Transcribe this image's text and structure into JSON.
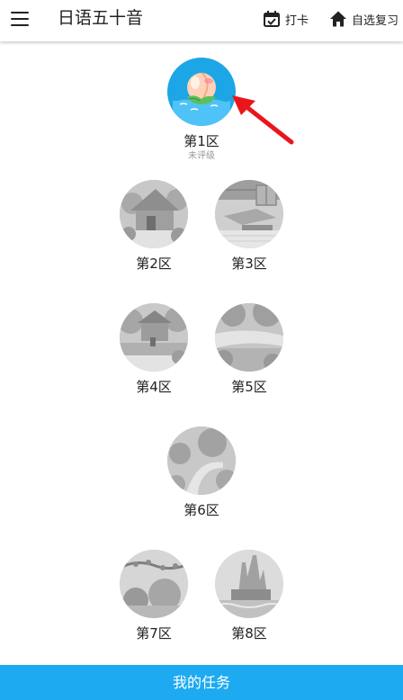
{
  "header": {
    "title": "日语五十音",
    "checkin_label": "打卡",
    "review_label": "自选复习"
  },
  "areas": [
    {
      "name": "第1区",
      "rating": "未评级"
    },
    {
      "name": "第2区"
    },
    {
      "name": "第3区"
    },
    {
      "name": "第4区"
    },
    {
      "name": "第5区"
    },
    {
      "name": "第6区"
    },
    {
      "name": "第7区"
    },
    {
      "name": "第8区"
    }
  ],
  "bottom": {
    "tasks_label": "我的任务"
  },
  "colors": {
    "accent": "#1eaaf1",
    "arrow": "#e8161c",
    "locked_gray": "#bdbdbd"
  },
  "icons": [
    "menu-icon",
    "calendar-check-icon",
    "home-icon",
    "peach-icon",
    "arrow-icon"
  ]
}
